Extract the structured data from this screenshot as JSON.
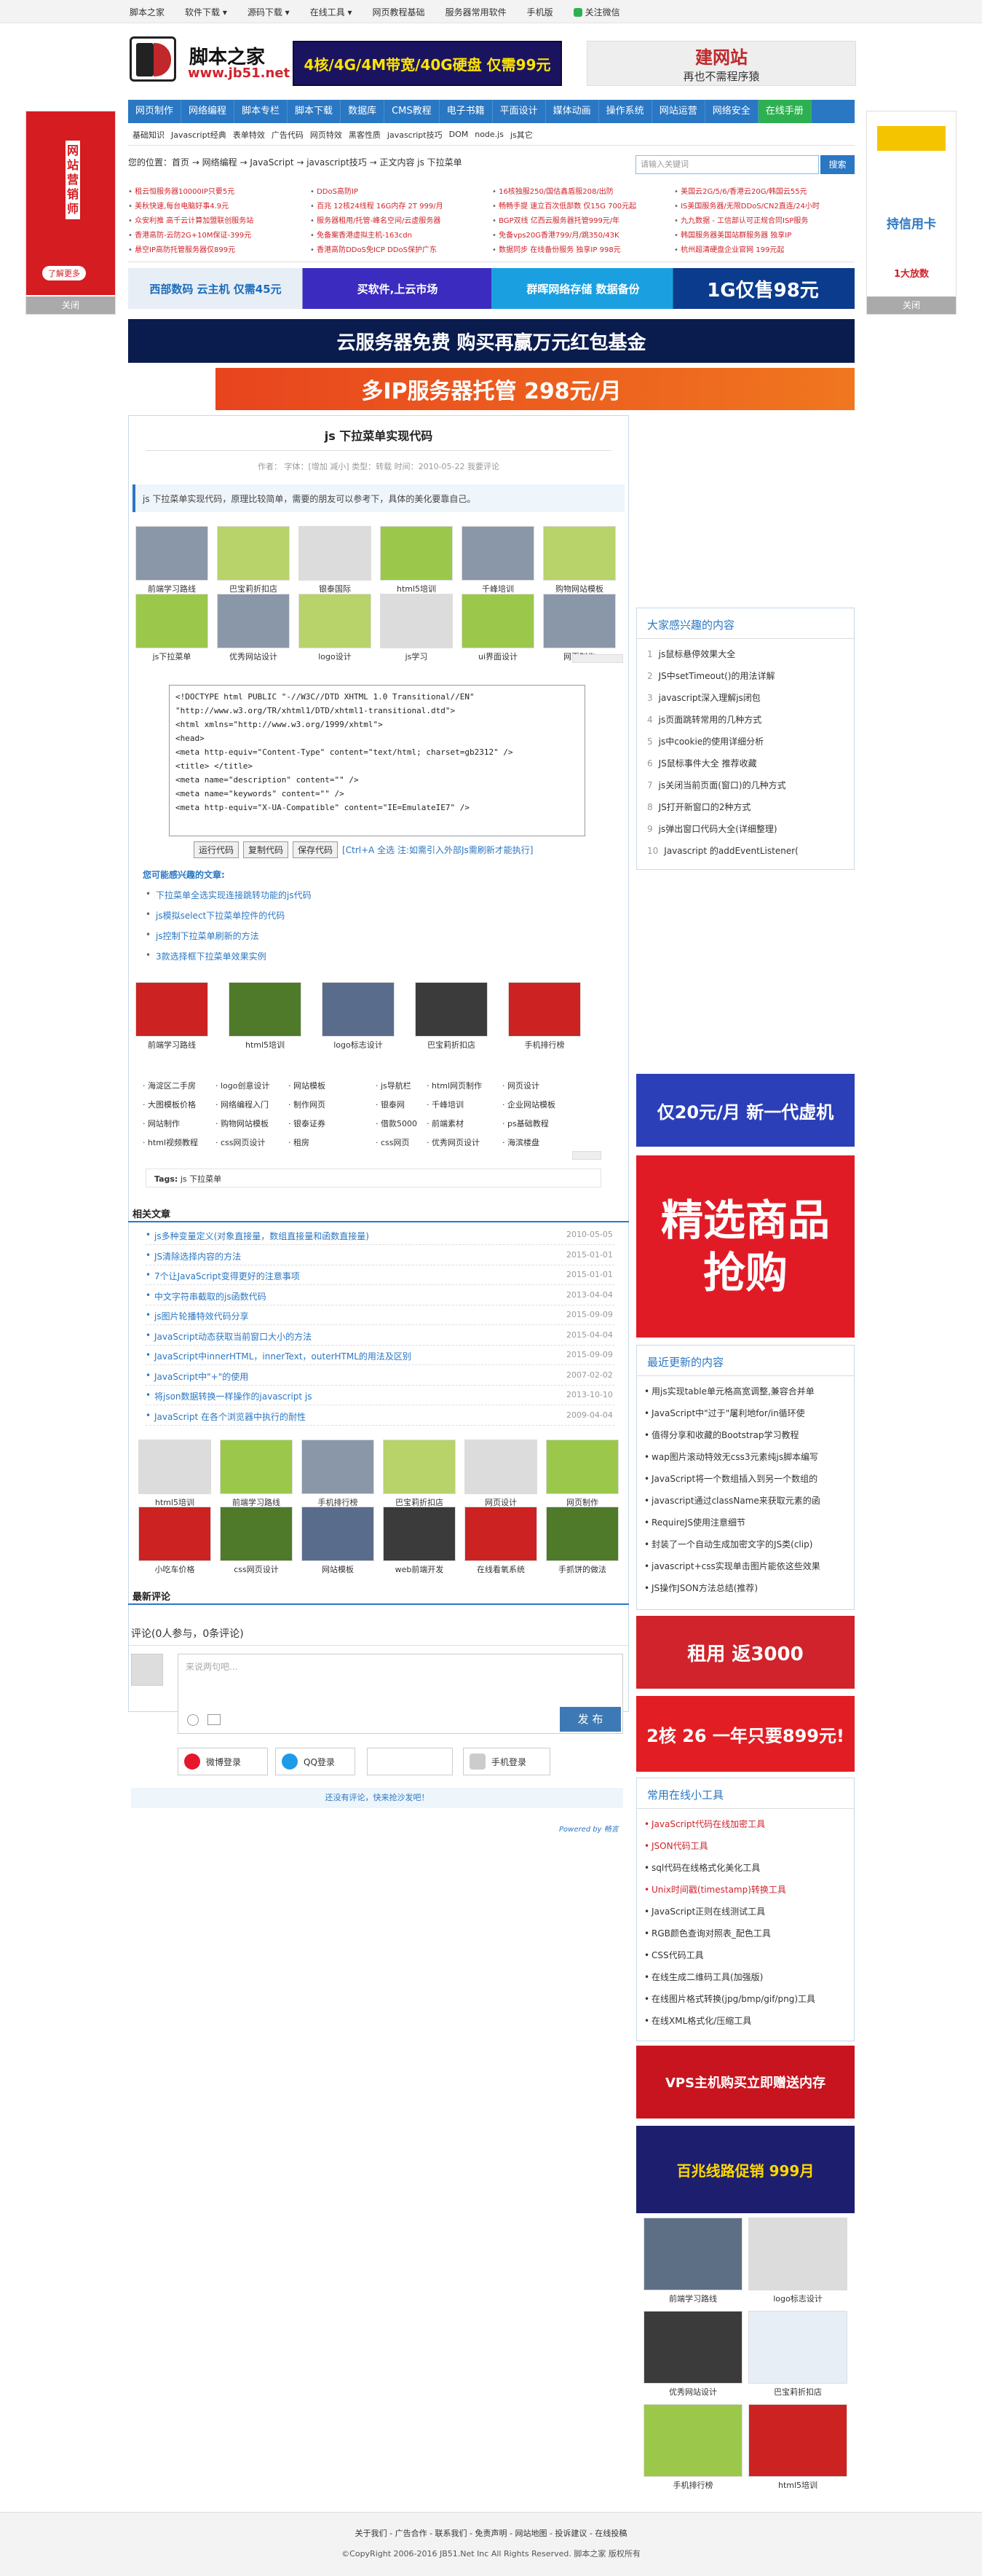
{
  "topbar": {
    "items": [
      "脚本之家",
      "软件下载 ▾",
      "源码下载 ▾",
      "在线工具 ▾",
      "网页教程基础",
      "服务器常用软件",
      "手机版",
      "关注微信"
    ]
  },
  "logo": {
    "name": "脚本之家",
    "url": "www.jb51.net"
  },
  "ads": {
    "top1": "4核/4G/4M带宽/40G硬盘 仅需99元",
    "top2_title": "建网站",
    "top2_sub": "再也不需程序猿",
    "left_side": "网站营销师",
    "left_btn": "了解更多",
    "left_close": "关闭",
    "right_side_title": "持信用卡",
    "right_side_sub": "1大放数",
    "right_close": "关闭",
    "b1": "西部数码 云主机 仅需45元",
    "b2": "买软件,上云市场",
    "b3": "群晖网络存储 数据备份",
    "b4": "1G仅售98元",
    "b5": "云服务器免费 购买再赢万元红包基金",
    "b6": "多IP服务器托管 298元/月",
    "r1": "仅20元/月 新一代虚机",
    "r2": "精选商品 抢购",
    "r3": "租用 返3000",
    "r4": "2核 26 一年只要899元!",
    "r5": "VPS主机购买立即赠送内存",
    "r6": "百兆线路促销 999月"
  },
  "nav": {
    "items": [
      "网页制作",
      "网络编程",
      "脚本专栏",
      "脚本下载",
      "数据库",
      "CMS教程",
      "电子书籍",
      "平面设计",
      "媒体动画",
      "操作系统",
      "网站运营",
      "网络安全",
      "在线手册"
    ]
  },
  "subnav": {
    "items": [
      "基础知识",
      "Javascript经典",
      "表单特效",
      "广告代码",
      "网页特效",
      "黑客性质",
      "javascript技巧",
      "DOM",
      "node.js",
      "js其它"
    ]
  },
  "crumb": "您的位置：首页 → 网络编程 → JavaScript → javascript技巧 → 正文内容 js 下拉菜单",
  "search": {
    "placeholder": "请输入关键词",
    "button": "搜索"
  },
  "links": [
    [
      "租云恒服务器10000IP只要5元",
      "DDoS高防IP",
      "16核独服250/国估鑫盾服208/出防",
      "美国云2G/5/6/香港云20G/韩国云55元"
    ],
    [
      "美秋快速,每台电脑好事4.9元",
      "百兆 12核24线程 16G内存 2T 999/月",
      "畅畅手提 速立百次低部数 仅15G 700元起",
      "IS美国服务器/无限DDoS/CN2直连/24小时"
    ],
    [
      "众安利推 高千云计算加盟联创服务站",
      "服务器租用/托管-峰名空间/云虚服务器",
      "BGP双线 亿西云服务器托管999元/年",
      "九九数据 - 工信部认可正规合同ISP服务"
    ],
    [
      "香港高防-云防2G+10M保证-399元",
      "免备案香港虚拟主机-163cdn",
      "免备vps20G香港799/月/跳350/43K",
      "韩国服务器美国站群服务器 独享IP"
    ],
    [
      "悬空IP高防托管服务器仅899元",
      "香港高防DDoS免ICP DDoS保护广东",
      "数据同步 在线备份服务 独享IP 998元",
      "杭州超清硬盘企业官网 199元起"
    ]
  ],
  "article": {
    "title": "js 下拉菜单实现代码",
    "meta": "作者：  字体：[增加 减小] 类型：转载 时间：2010-05-22  我要评论",
    "intro": "js 下拉菜单实现代码，原理比较简单，需要的朋友可以参考下，具体的美化要靠自己。",
    "thumbs1": [
      "前端学习路线",
      "巴宝莉折扣店",
      "银泰国际",
      "html5培训",
      "千峰培训",
      "购物网站模板"
    ],
    "thumbs2": [
      "js下拉菜单",
      "优秀网站设计",
      "logo设计",
      "js学习",
      "ui界面设计",
      "网页制作"
    ],
    "code": [
      "<!DOCTYPE html PUBLIC \"-//W3C//DTD XHTML 1.0 Transitional//EN\" \"http://www.w3.org/TR/xhtml1/DTD/xhtml1-transitional.dtd\">",
      "<html xmlns=\"http://www.w3.org/1999/xhtml\">",
      "<head>",
      "<meta http-equiv=\"Content-Type\" content=\"text/html; charset=gb2312\" />",
      "<title> </title>",
      "<meta name=\"description\" content=\"\" />",
      "<meta name=\"keywords\" content=\"\" />",
      "<meta http-equiv=\"X-UA-Compatible\" content=\"IE=EmulateIE7\" />"
    ],
    "btn_run": "运行代码",
    "btn_copy": "复制代码",
    "btn_save": "保存代码",
    "btn_tip": "[Ctrl+A 全选 注:如需引入外部Js需刷新才能执行]",
    "related_head": "您可能感兴趣的文章:",
    "related": [
      "下拉菜单全选实现连接跳转功能的js代码",
      "js模拟select下拉菜单控件的代码",
      "js控制下拉菜单刷新的方法",
      "3款选择框下拉菜单效果实例"
    ],
    "thumbs3": [
      "前端学习路线",
      "html5培训",
      "logo标志设计",
      "巴宝莉折扣店",
      "手机排行榜"
    ],
    "grid": [
      [
        "海淀区二手房",
        "logo创意设计",
        "网站模板",
        "js导航栏",
        "html网页制作",
        "网页设计"
      ],
      [
        "大图模板价格",
        "网络编程入门",
        "制作网页",
        "银泰网",
        "千峰培训",
        "企业网站模板"
      ],
      [
        "网站制作",
        "购物网站模板",
        "银泰证券",
        "借款5000",
        "前端素材",
        "ps基础教程"
      ],
      [
        "html视频教程",
        "css网页设计",
        "租房",
        "css网页",
        "优秀网页设计",
        "海滨楼盘"
      ]
    ],
    "tags_label": "Tags:",
    "tags": "js 下拉菜单"
  },
  "news": {
    "head": "相关文章",
    "items": [
      [
        "js多种变量定义(对象直接量，数组直接量和函数直接量)",
        "2010-05-05"
      ],
      [
        "JS清除选择内容的方法",
        "2015-01-01"
      ],
      [
        "7个让JavaScript变得更好的注意事项",
        "2015-01-01"
      ],
      [
        "中文字符串截取的js函数代码",
        "2013-04-04"
      ],
      [
        "js图片轮播特效代码分享",
        "2015-09-09"
      ],
      [
        "JavaScript动态获取当前窗口大小的方法",
        "2015-04-04"
      ],
      [
        "JavaScript中innerHTML，innerText，outerHTML的用法及区别",
        "2015-09-09"
      ],
      [
        "JavaScript中\"+\"的使用",
        "2007-02-02"
      ],
      [
        "将json数据转换一样操作的javascript js",
        "2013-10-10"
      ],
      [
        "JavaScript 在各个浏览器中执行的耐性",
        "2009-04-04"
      ]
    ],
    "thumbs": [
      "html5培训",
      "前端学习路线",
      "手机排行榜",
      "巴宝莉折扣店",
      "网页设计",
      "网页制作"
    ],
    "thumbs2": [
      "小吃车价格",
      "css网页设计",
      "网站模板",
      "web前端开发",
      "在线看氧系统",
      "手抓饼的做法"
    ]
  },
  "comments": {
    "head": "最新评论",
    "title": "评论(0人参与，0条评论)",
    "placeholder": "来说两句吧...",
    "post": "发 布",
    "weibo": "微博登录",
    "qq": "QQ登录",
    "phone": "手机登录",
    "prompt": "还没有评论，快来抢沙发吧！",
    "powered": "Powered by 畅言"
  },
  "right": {
    "interest_head": "大家感兴趣的内容",
    "interest": [
      "js鼠标悬停效果大全",
      "JS中setTimeout()的用法详解",
      "javascript深入理解js闭包",
      "js页面跳转常用的几种方式",
      "js中cookie的使用详细分析",
      "JS鼠标事件大全 推荐收藏",
      "js关闭当前页面(窗口)的几种方式",
      "JS打开新窗口的2种方式",
      "js弹出窗口代码大全(详细整理)",
      "Javascript 的addEventListener("
    ],
    "recent_head": "最近更新的内容",
    "recent": [
      "用js实现table单元格高宽调整,兼容合并单",
      "JavaScript中\"过于\"屠利地for/in循环使",
      "值得分享和收藏的Bootstrap学习教程",
      "wap图片滚动特效无css3元素纯js脚本编写",
      "JavaScript将一个数组插入到另一个数组的",
      "javascript通过className来获取元素的函",
      "RequireJS使用注意细节",
      "封装了一个自动生成加密文字的JS类(clip)",
      "javascript+css实现单击图片能依这些效果",
      "JS操作JSON方法总结(推荐)"
    ],
    "tools_head": "常用在线小工具",
    "tools": [
      "JavaScript代码在线加密工具",
      "JSON代码工具",
      "sql代码在线格式化美化工具",
      "Unix时间戳(timestamp)转换工具",
      "JavaScript正则在线测试工具",
      "RGB颜色查询对照表_配色工具",
      "CSS代码工具",
      "在线生成二维码工具(加强版)",
      "在线图片格式转换(jpg/bmp/gif/png)工具",
      "在线XML格式化/压缩工具"
    ],
    "thumbs": [
      "前端学习路线",
      "logo标志设计",
      "优秀网站设计",
      "巴宝莉折扣店",
      "手机排行榜",
      "html5培训"
    ]
  },
  "footer": {
    "links": "关于我们 - 广告合作 - 联系我们 - 免责声明 - 网站地图 - 投诉建议 - 在线投稿",
    "copy": "©CopyRight 2006-2016 JB51.Net Inc All Rights Reserved. 脚本之家 版权所有"
  }
}
